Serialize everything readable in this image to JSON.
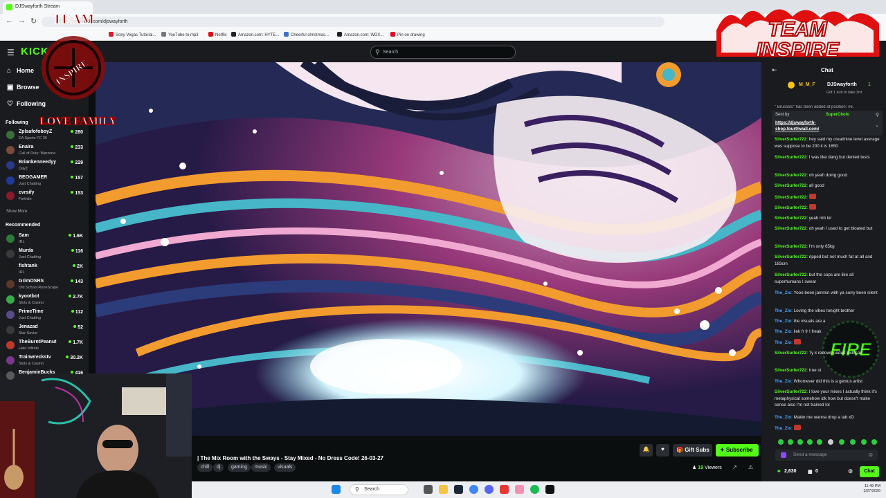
{
  "browser": {
    "tab_title": "DJSwayforth Stream",
    "url": "kick.com/djswayforth",
    "bookmarks": [
      {
        "label": "Sony Vegas Tutorial...",
        "color": "#e01b24"
      },
      {
        "label": "YouTube to mp3",
        "color": "#777777"
      },
      {
        "label": "Netflix",
        "color": "#e50914"
      },
      {
        "label": "Amazon.com: HYTE...",
        "color": "#222222"
      },
      {
        "label": "Cheerful christmas...",
        "color": "#3b6fd1"
      },
      {
        "label": "Amazon.com: WDX...",
        "color": "#222222"
      },
      {
        "label": "Pin on drawing",
        "color": "#e60023"
      }
    ]
  },
  "nav": {
    "logo": "KICK",
    "search_placeholder": "Search",
    "items": [
      {
        "label": "Home"
      },
      {
        "label": "Browse"
      },
      {
        "label": "Following"
      }
    ]
  },
  "sidebar": {
    "following_label": "Following",
    "following": [
      {
        "name": "ZplsafofoboyZ",
        "game": "EA Sports FC 26",
        "viewers": "280",
        "color": "#3c6e3c"
      },
      {
        "name": "Enaira",
        "game": "Call of Duty: Warzone",
        "viewers": "233",
        "color": "#7a4b3a"
      },
      {
        "name": "Briankenneedyy",
        "game": "DayZ",
        "viewers": "229",
        "color": "#2a3a8a"
      },
      {
        "name": "BEOGAMER",
        "game": "Just Chatting",
        "viewers": "157",
        "color": "#203a9a"
      },
      {
        "name": "cvrsify",
        "game": "Fortnite",
        "viewers": "153",
        "color": "#8a1a2a"
      }
    ],
    "show_more": "Show More",
    "recommended_label": "Recommended",
    "recommended": [
      {
        "name": "Sam",
        "game": "IRL",
        "viewers": "1.6K",
        "color": "#2d7a3a"
      },
      {
        "name": "Murda",
        "game": "Just Chatting",
        "viewers": "116",
        "color": "#3a3a3a"
      },
      {
        "name": "fishtank",
        "game": "IRL",
        "viewers": "2K",
        "color": "#1a1a1a"
      },
      {
        "name": "GrimOSRS",
        "game": "Old School RuneScape",
        "viewers": "143",
        "color": "#5a3a2a"
      },
      {
        "name": "kyootbot",
        "game": "Slots & Casino",
        "viewers": "2.7K",
        "color": "#3aaa4a"
      },
      {
        "name": "PrimeTime",
        "game": "Just Chatting",
        "viewers": "112",
        "color": "#5a4a8a"
      },
      {
        "name": "Jenazad",
        "game": "Star Savior",
        "viewers": "52",
        "color": "#3a3a3a"
      },
      {
        "name": "TheBurntPeanut",
        "game": "Halo Infinite",
        "viewers": "1.7K",
        "color": "#c0392b"
      },
      {
        "name": "Trainwreckstv",
        "game": "Slots & Casino",
        "viewers": "30.2K",
        "color": "#7a3a8a"
      },
      {
        "name": "BenjaminBucks",
        "game": "",
        "viewers": "416",
        "color": "#5a5a5a"
      }
    ]
  },
  "stream": {
    "title": "| The Mix Room with the Sways - Stay Mixed - No Dress Code! 26-03-27",
    "tags": [
      "chill",
      "dj",
      "gaming",
      "music",
      "visuals"
    ],
    "gift_subs_label": "Gift Subs",
    "subscribe_label": "Subscribe",
    "viewers_count": "19",
    "viewers_label": "Viewers"
  },
  "chat": {
    "title": "Chat",
    "pinned_user_top": "M_M_F",
    "pinned_channel": "DJSwayforth",
    "pinned_sub_count": "1",
    "pinned_note": "Gift 1 sub to take 3rd",
    "pinned_sent_by_label": "Sent by",
    "pinned_sent_by_user": "SuperCholo",
    "pinned_link": "https://djswayforth-shop.fourthwall.com/",
    "clipped_line": "\" Brussels\" has been added at position: #6.",
    "messages": [
      {
        "user": "SilverSurfer722",
        "text": "hey said my creatinine level average was suppose to be 200 it is 1650",
        "color": "#53fc18"
      },
      {
        "user": "SilverSurfer722",
        "text": "I was like dang but denied tests",
        "color": "#53fc18"
      },
      {
        "user": "SilverSurfer722",
        "text": "oh yeah doing good",
        "color": "#53fc18"
      },
      {
        "user": "SilverSurfer722",
        "text": "all good",
        "color": "#53fc18"
      },
      {
        "user": "SilverSurfer722",
        "text": "",
        "color": "#53fc18"
      },
      {
        "user": "SilverSurfer722",
        "text": "",
        "color": "#53fc18"
      },
      {
        "user": "SilverSurfer722",
        "text": "yeah mb lol",
        "color": "#53fc18"
      },
      {
        "user": "SilverSurfer722",
        "text": "oh yeah I used to get bloated but",
        "color": "#53fc18"
      },
      {
        "user": "SilverSurfer722",
        "text": "I'm only 65kg",
        "color": "#53fc18"
      },
      {
        "user": "SilverSurfer722",
        "text": "ripped but not much fat at all and 183cm",
        "color": "#53fc18"
      },
      {
        "user": "SilverSurfer722",
        "text": "but the cops are like all superhumans I swear",
        "color": "#53fc18"
      },
      {
        "user": "The_Zio",
        "text": "Yooo been jammin with ya sorry been silent",
        "color": "#4aa3ff"
      },
      {
        "user": "The_Zio",
        "text": "Loving the vibes tonight brother",
        "color": "#4aa3ff"
      },
      {
        "user": "The_Zio",
        "text": "the visuals are a",
        "color": "#4aa3ff"
      },
      {
        "user": "The_Zio",
        "text": "liek fr fr I freak",
        "color": "#4aa3ff"
      },
      {
        "user": "The_Zio",
        "text": "",
        "color": "#4aa3ff"
      },
      {
        "user": "SilverSurfer722",
        "text": "Ty k redownipaded kick sav",
        "color": "#53fc18"
      },
      {
        "user": "SilverSurfer722",
        "text": "true st",
        "color": "#53fc18"
      },
      {
        "user": "The_Zio",
        "text": "Whomever did this is a genius artist",
        "color": "#4aa3ff"
      },
      {
        "user": "SilverSurfer722",
        "text": "I love your mixes I actually think it's metaphysical somehow idk how but doesn't make sense also I'm not trained lol",
        "color": "#53fc18"
      },
      {
        "user": "The_Zio",
        "text": "Makin me wanna drop a tab xD",
        "color": "#4aa3ff"
      },
      {
        "user": "The_Zio",
        "text": "",
        "color": "#4aa3ff"
      }
    ],
    "input_placeholder": "Send a message",
    "kicks_count": "2,630",
    "gift_count": "0",
    "chat_button": "Chat"
  },
  "taskbar": {
    "search_label": "Search",
    "time": "11:49 PM",
    "date": "3/27/2026"
  },
  "overlays": {
    "team_logo_text": "TEAM INSPIRE",
    "emblem_text": "TEAM INSPIRE LOVE FAMILY",
    "fire_badge_text": "FIRE"
  },
  "colors": {
    "kick_green": "#53fc18",
    "background": "#0b0e0f",
    "panel": "#191b1f",
    "zio_blue": "#4aa3ff"
  }
}
